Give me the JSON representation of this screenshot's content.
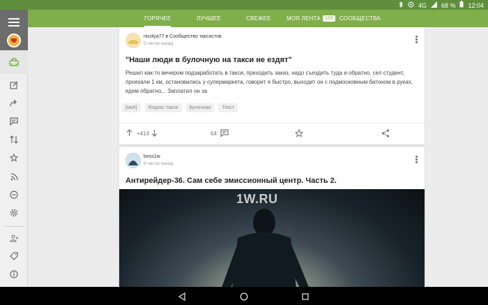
{
  "status_bar": {
    "network": "4G",
    "battery": "68 %",
    "time": "12:04",
    "icons": [
      "bluetooth-icon",
      "alarm-icon",
      "signal-icon",
      "battery-icon"
    ]
  },
  "tabs": [
    {
      "label": "ГОРЯЧЕЕ",
      "active": true
    },
    {
      "label": "ЛУЧШЕЕ",
      "active": false
    },
    {
      "label": "СВЕЖЕЕ",
      "active": false
    },
    {
      "label": "МОЯ ЛЕНТА",
      "badge": "106",
      "active": false
    },
    {
      "label": "СООБЩЕСТВА",
      "active": false
    }
  ],
  "sidebar": {
    "icons": [
      "menu-icon",
      "logo-icon",
      "home-icon",
      "edit-icon",
      "share-icon",
      "comments-icon",
      "sort-icon",
      "star-icon",
      "rss-icon",
      "minus-icon",
      "settings-icon",
      "users-icon",
      "tag-icon",
      "info-icon"
    ]
  },
  "posts": [
    {
      "author": "nicolya77 в Сообщество таксистов",
      "time": "5 часов назад",
      "title": "\"Наши люди в булочную на такси не ездят\"",
      "excerpt": "Решил как-то вечером подзаработать в такси, приходить заказ, надо съездить туда и обратно, сел студент, проехали 1 км, остановились у супермаркета, говорит я быстро, выходит он с подмосковным батоном в руках, едем обратно... Заплатил он за",
      "tags": [
        "[моё]",
        "Яндекс такси",
        "Булочная",
        "Текст"
      ],
      "rating": "+414",
      "comments": "64"
    },
    {
      "author": "boss1w",
      "time": "9 часов назад",
      "title": "Антирейдер-36. Сам себе эмиссионный центр. Часть 2.",
      "image_logo": "1W.RU"
    }
  ],
  "colors": {
    "status_bar": "#5f8f3c",
    "tabs_bar": "#7fae4a",
    "sidebar": "#f0f0f0"
  }
}
